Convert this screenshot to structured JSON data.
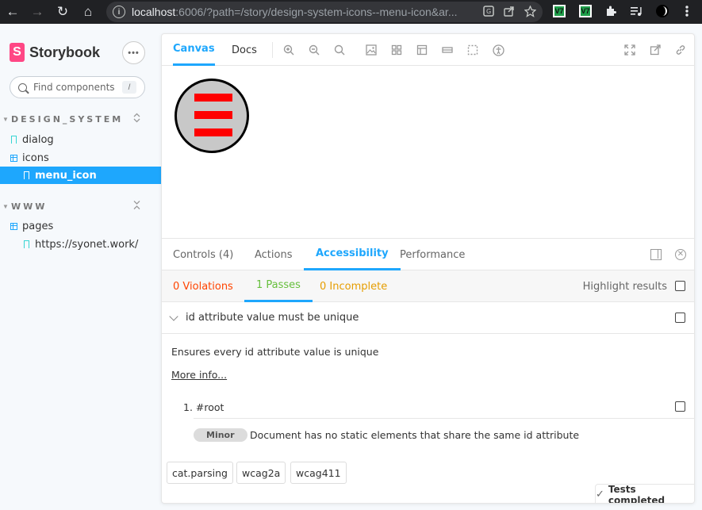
{
  "browser": {
    "url_host": "localhost",
    "url_rest": ":6006/?path=/story/design-system-icons--menu-icon&ar...",
    "back_glyph": "←",
    "forward_glyph": "→",
    "reload_glyph": "↻",
    "home_glyph": "⌂",
    "info_glyph": "i",
    "ext_label": "V7"
  },
  "sidebar": {
    "brand_letter": "S",
    "brand_name": "Storybook",
    "menu_dots": "•••",
    "search_placeholder": "Find components",
    "search_shortcut": "/",
    "groups": [
      {
        "label": "DESIGN_SYSTEM",
        "items": [
          {
            "label": "dialog",
            "type": "story"
          },
          {
            "label": "icons",
            "type": "component"
          },
          {
            "label": "menu_icon",
            "type": "story",
            "selected": true
          }
        ]
      },
      {
        "label": "WWW",
        "items": [
          {
            "label": "pages",
            "type": "component"
          },
          {
            "label": "https://syonet.work/",
            "type": "story"
          }
        ]
      }
    ]
  },
  "toolbar": {
    "tabs": [
      "Canvas",
      "Docs"
    ],
    "active_tab": "Canvas"
  },
  "addons": {
    "tabs": [
      "Controls (4)",
      "Actions",
      "Accessibility",
      "Performance"
    ],
    "active_tab": "Accessibility"
  },
  "a11y": {
    "violations": "0 Violations",
    "passes": "1 Passes",
    "incomplete": "0 Incomplete",
    "highlight_label": "Highlight results",
    "rule_title": "id attribute value must be unique",
    "description": "Ensures every id attribute value is unique",
    "more_info": "More info...",
    "node": "1. #root",
    "impact": "Minor",
    "impact_text": "Document has no static elements that share the same id attribute",
    "tags": [
      "cat.parsing",
      "wcag2a",
      "wcag411"
    ],
    "status": "Tests completed"
  },
  "colors": {
    "accent": "#1ea7fd",
    "brand": "#ff4785",
    "violations": "#ff4400",
    "passes": "#66bf3c",
    "incomplete": "#e69d00",
    "icon_fill": "#c8c8c8",
    "icon_bars": "#ff0000"
  }
}
